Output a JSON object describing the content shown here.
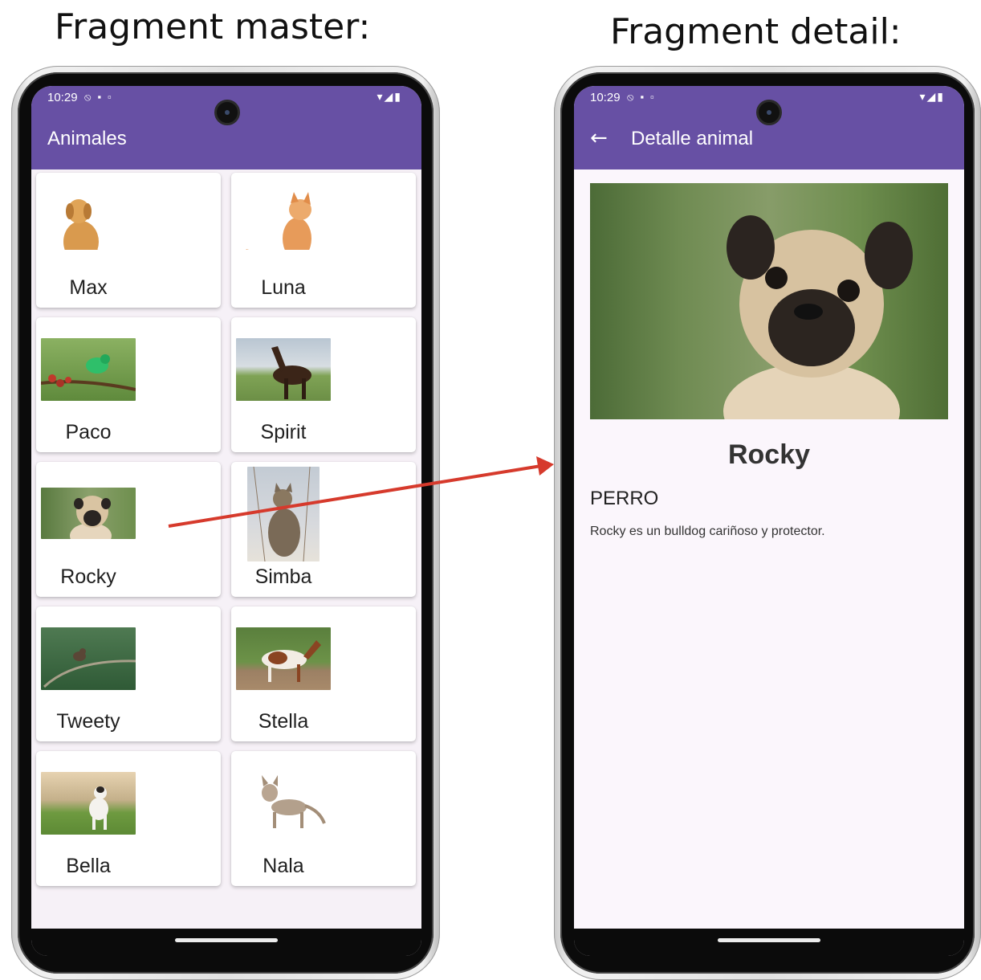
{
  "headings": {
    "left": "Fragment master:",
    "right": "Fragment detail:"
  },
  "status_bar": {
    "time": "10:29"
  },
  "master": {
    "title": "Animales",
    "animals": [
      {
        "name": "Max"
      },
      {
        "name": "Luna"
      },
      {
        "name": "Paco"
      },
      {
        "name": "Spirit"
      },
      {
        "name": "Rocky"
      },
      {
        "name": "Simba"
      },
      {
        "name": "Tweety"
      },
      {
        "name": "Stella"
      },
      {
        "name": "Bella"
      },
      {
        "name": "Nala"
      }
    ]
  },
  "detail": {
    "title": "Detalle animal",
    "name": "Rocky",
    "type": "PERRO",
    "description": "Rocky es un bulldog cariñoso y protector."
  },
  "colors": {
    "app_bar": "#6750a4",
    "arrow": "#d63a2c"
  }
}
